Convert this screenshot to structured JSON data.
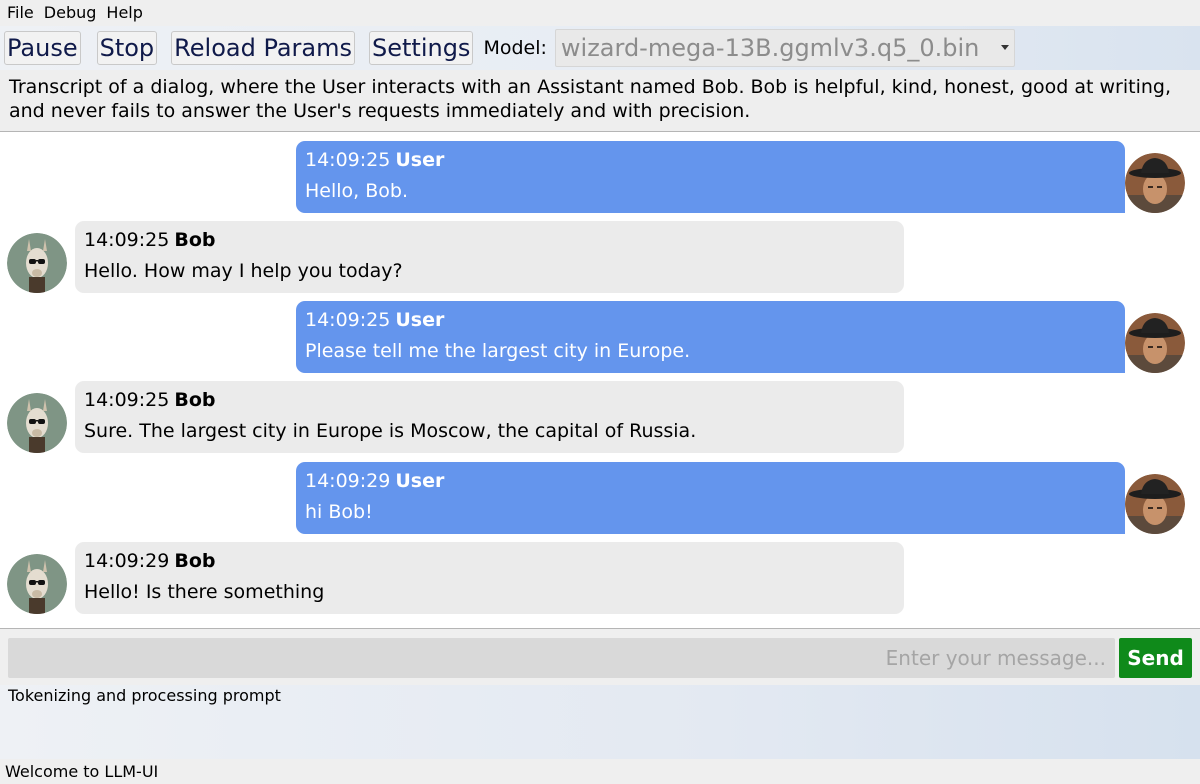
{
  "menu": [
    "File",
    "Debug",
    "Help"
  ],
  "toolbar": {
    "pause": "Pause",
    "stop": "Stop",
    "reload": "Reload Params",
    "settings": "Settings",
    "model_label": "Model:",
    "model_value": "wizard-mega-13B.ggmlv3.q5_0.bin"
  },
  "system_prompt": "Transcript of a dialog, where the User interacts with an Assistant named Bob. Bob is helpful, kind, honest, good at writing, and never fails to answer the User's requests immediately and with precision.",
  "messages": [
    {
      "role": "user",
      "time": "14:09:25",
      "name": "User",
      "text": "Hello, Bob."
    },
    {
      "role": "bot",
      "time": "14:09:25",
      "name": "Bob",
      "text": "Hello. How may I help you today?"
    },
    {
      "role": "user",
      "time": "14:09:25",
      "name": "User",
      "text": "Please tell me the largest city in Europe."
    },
    {
      "role": "bot",
      "time": "14:09:25",
      "name": "Bob",
      "text": "Sure. The largest city in Europe is Moscow, the capital of Russia."
    },
    {
      "role": "user",
      "time": "14:09:29",
      "name": "User",
      "text": "hi Bob!"
    },
    {
      "role": "bot",
      "time": "14:09:29",
      "name": "Bob",
      "text": "Hello! Is there something"
    }
  ],
  "input": {
    "placeholder": "Enter your message...",
    "send_label": "Send"
  },
  "status_log": "Tokenizing and processing prompt",
  "statusbar": "Welcome to LLM-UI",
  "colors": {
    "user_bubble": "#6495ed",
    "bot_bubble": "#ebebeb",
    "send_button": "#0f8a1a"
  }
}
